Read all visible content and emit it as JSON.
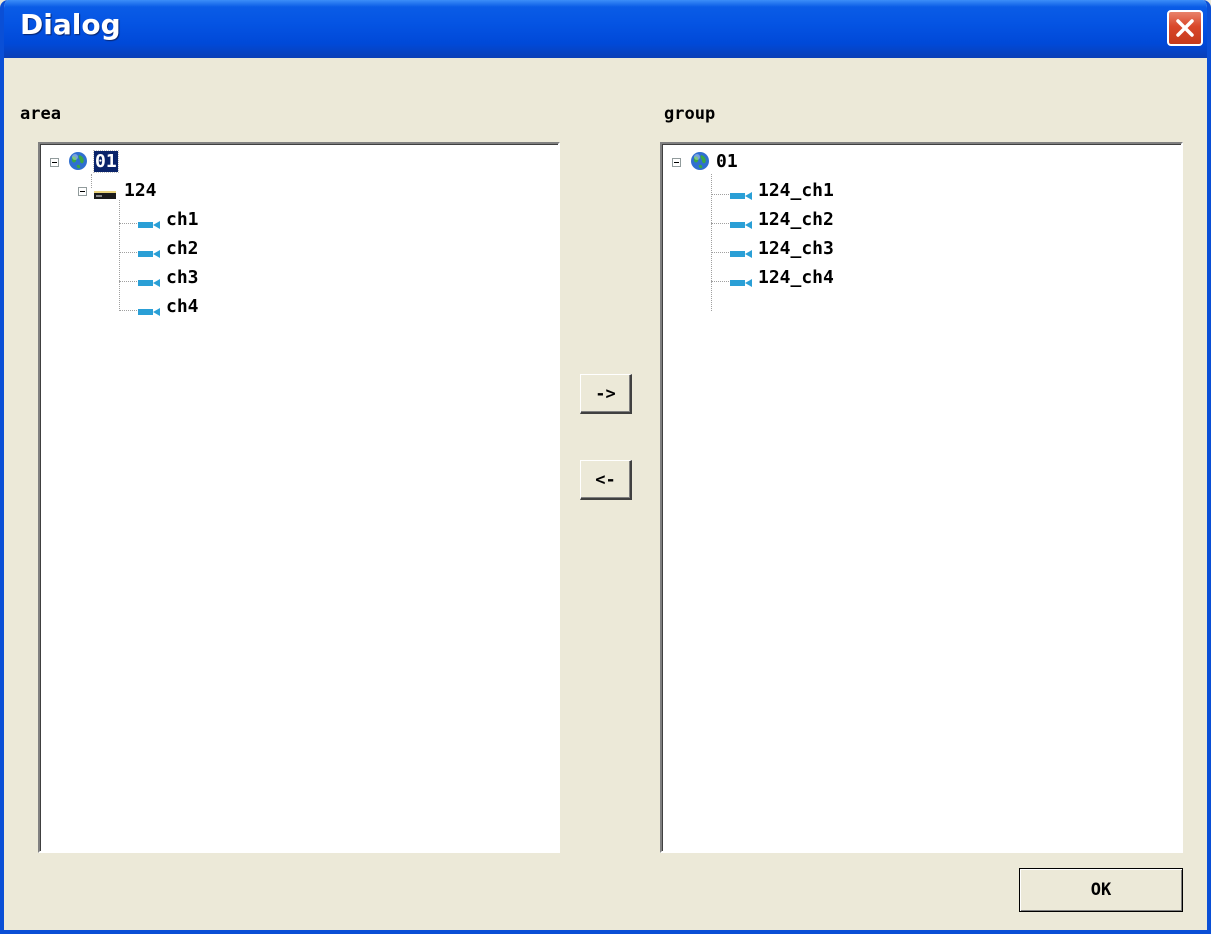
{
  "window": {
    "title": "Dialog"
  },
  "area": {
    "label": "area",
    "tree": {
      "root": "01",
      "device": "124",
      "channels": [
        "ch1",
        "ch2",
        "ch3",
        "ch4"
      ]
    }
  },
  "group": {
    "label": "group",
    "tree": {
      "root": "01",
      "channels": [
        "124_ch1",
        "124_ch2",
        "124_ch3",
        "124_ch4"
      ]
    }
  },
  "buttons": {
    "add": "->",
    "remove": "<-",
    "ok": "OK"
  },
  "colors": {
    "titlebar": "#0554e3",
    "window_bg": "#ece9d8",
    "selection": "#0a246a",
    "camera_icon": "#2a9fd6"
  },
  "icons": {
    "root": "globe-icon",
    "device": "dvr-device-icon",
    "channel": "camera-icon",
    "close": "close-icon"
  }
}
